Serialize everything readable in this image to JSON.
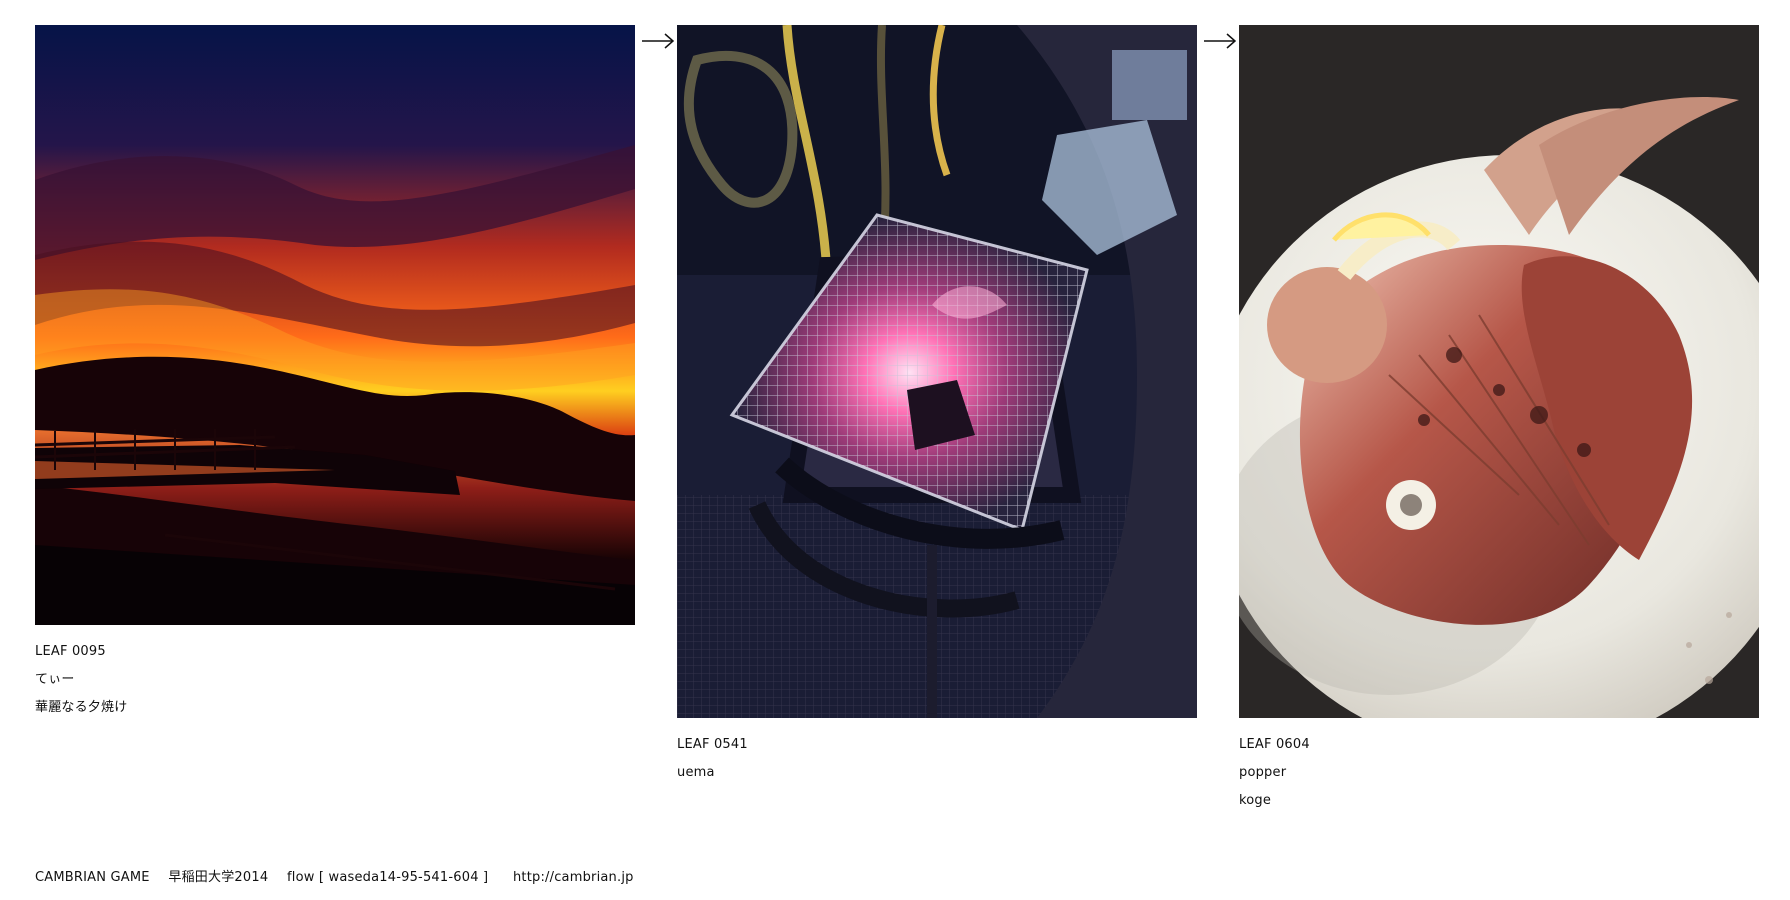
{
  "leaves": [
    {
      "id": "LEAF 0095",
      "author": "てぃー",
      "caption": "華麗なる夕焼け",
      "image": "sunset-over-water"
    },
    {
      "id": "LEAF 0541",
      "author": "uema",
      "caption": "",
      "image": "charcoal-grill"
    },
    {
      "id": "LEAF 0604",
      "author": "popper",
      "caption": "koge",
      "image": "grilled-fish-head-plate"
    }
  ],
  "arrows": [
    "right-arrow-icon",
    "right-arrow-icon"
  ],
  "footer": {
    "title": "CAMBRIAN GAME",
    "school": "早稲田大学2014",
    "flow": "flow [ waseda14-95-541-604 ]",
    "url": "http://cambrian.jp"
  },
  "colors": {
    "background": "#ffffff",
    "text": "#111111",
    "sunset_orange": "#ff5a1f",
    "night_blue": "#10184a",
    "grill_glow": "#ff6fb1",
    "plate": "#f1efe7"
  }
}
